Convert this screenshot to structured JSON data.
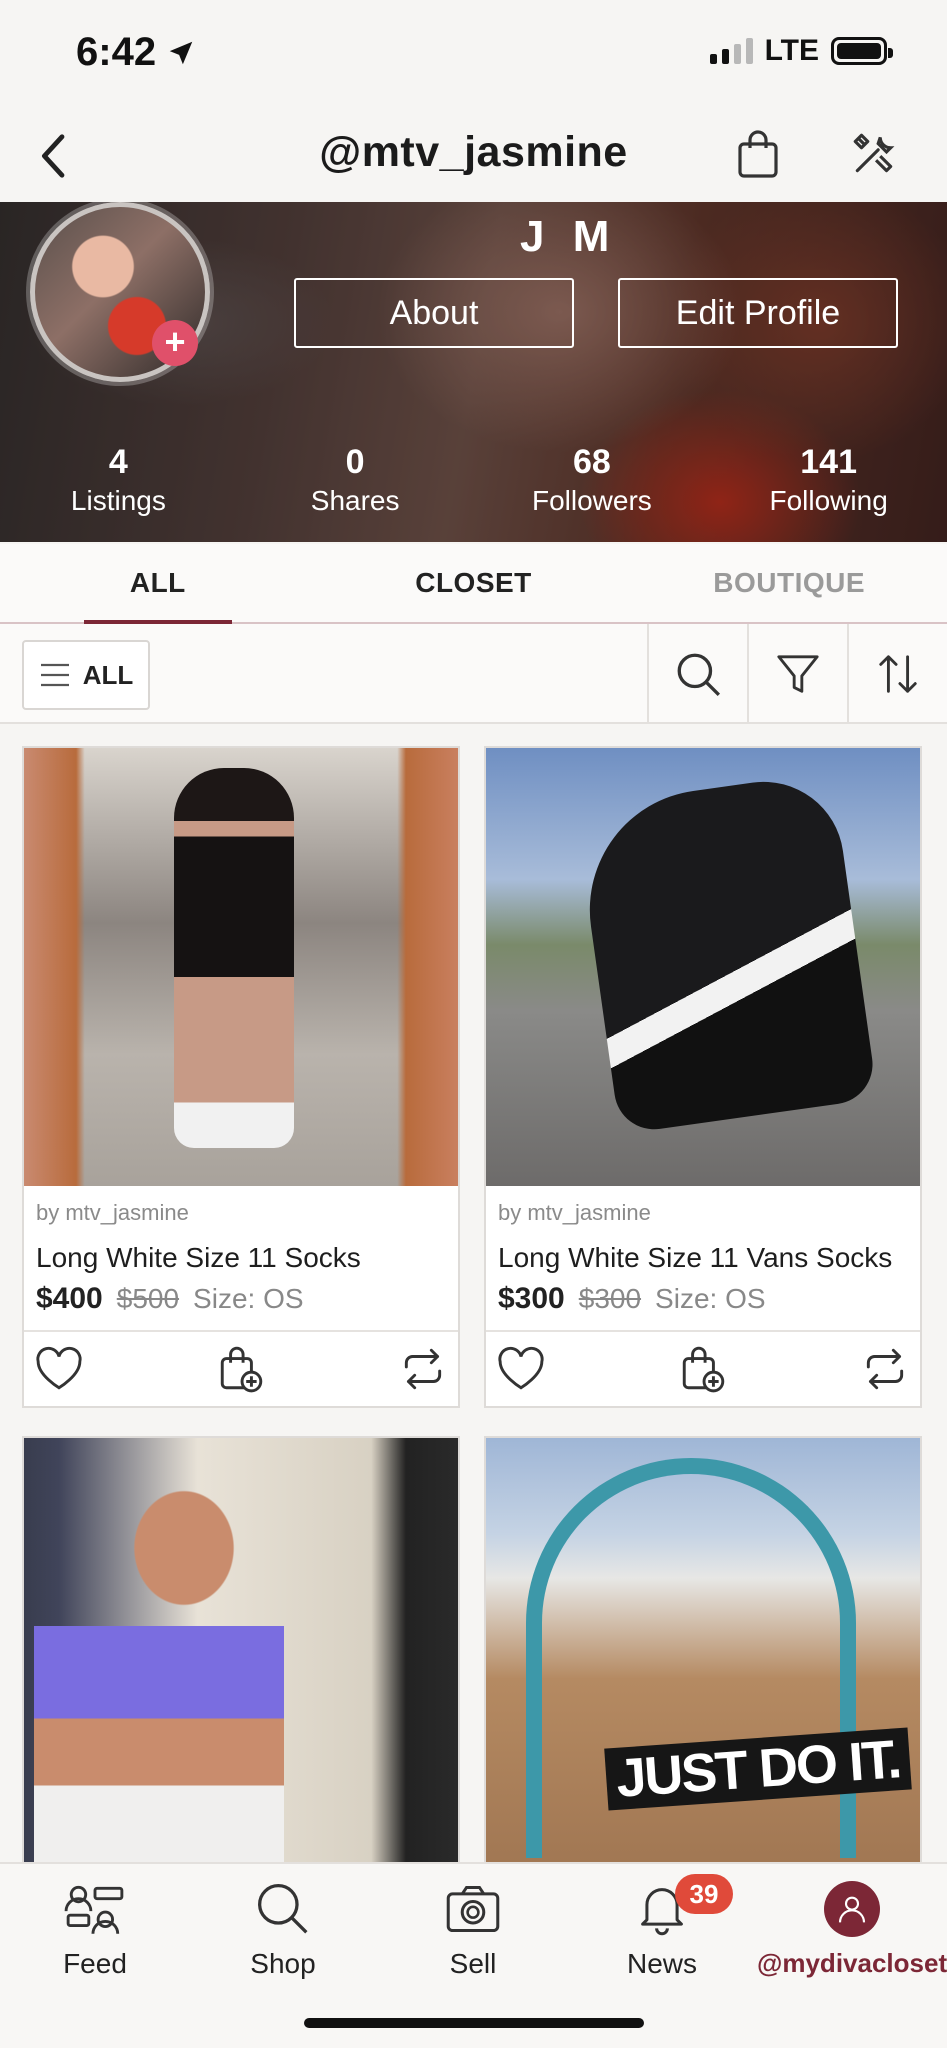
{
  "status_bar": {
    "time": "6:42",
    "network": "LTE"
  },
  "header": {
    "title": "@mtv_jasmine"
  },
  "profile": {
    "display_name": "J M",
    "about_label": "About",
    "edit_label": "Edit Profile",
    "stats": [
      {
        "value": "4",
        "label": "Listings"
      },
      {
        "value": "0",
        "label": "Shares"
      },
      {
        "value": "68",
        "label": "Followers"
      },
      {
        "value": "141",
        "label": "Following"
      }
    ]
  },
  "tabs": [
    {
      "label": "ALL",
      "active": true
    },
    {
      "label": "CLOSET",
      "active": false
    },
    {
      "label": "BOUTIQUE",
      "active": false
    }
  ],
  "filter": {
    "all_label": "ALL"
  },
  "listings": [
    {
      "by": "by mtv_jasmine",
      "title": "Long White Size 11 Socks",
      "price": "$400",
      "original_price": "$500",
      "size": "Size: OS"
    },
    {
      "by": "by mtv_jasmine",
      "title": "Long White Size 11 Vans Socks",
      "price": "$300",
      "original_price": "$300",
      "size": "Size: OS"
    },
    {
      "photo_text": "JUST DO IT."
    }
  ],
  "bottom_nav": {
    "feed": "Feed",
    "shop": "Shop",
    "sell": "Sell",
    "news": "News",
    "news_badge": "39",
    "me": "@mydivacloseth"
  },
  "colors": {
    "accent": "#7c2736",
    "badge": "#e04a3a",
    "avatar_plus": "#e0506a"
  }
}
